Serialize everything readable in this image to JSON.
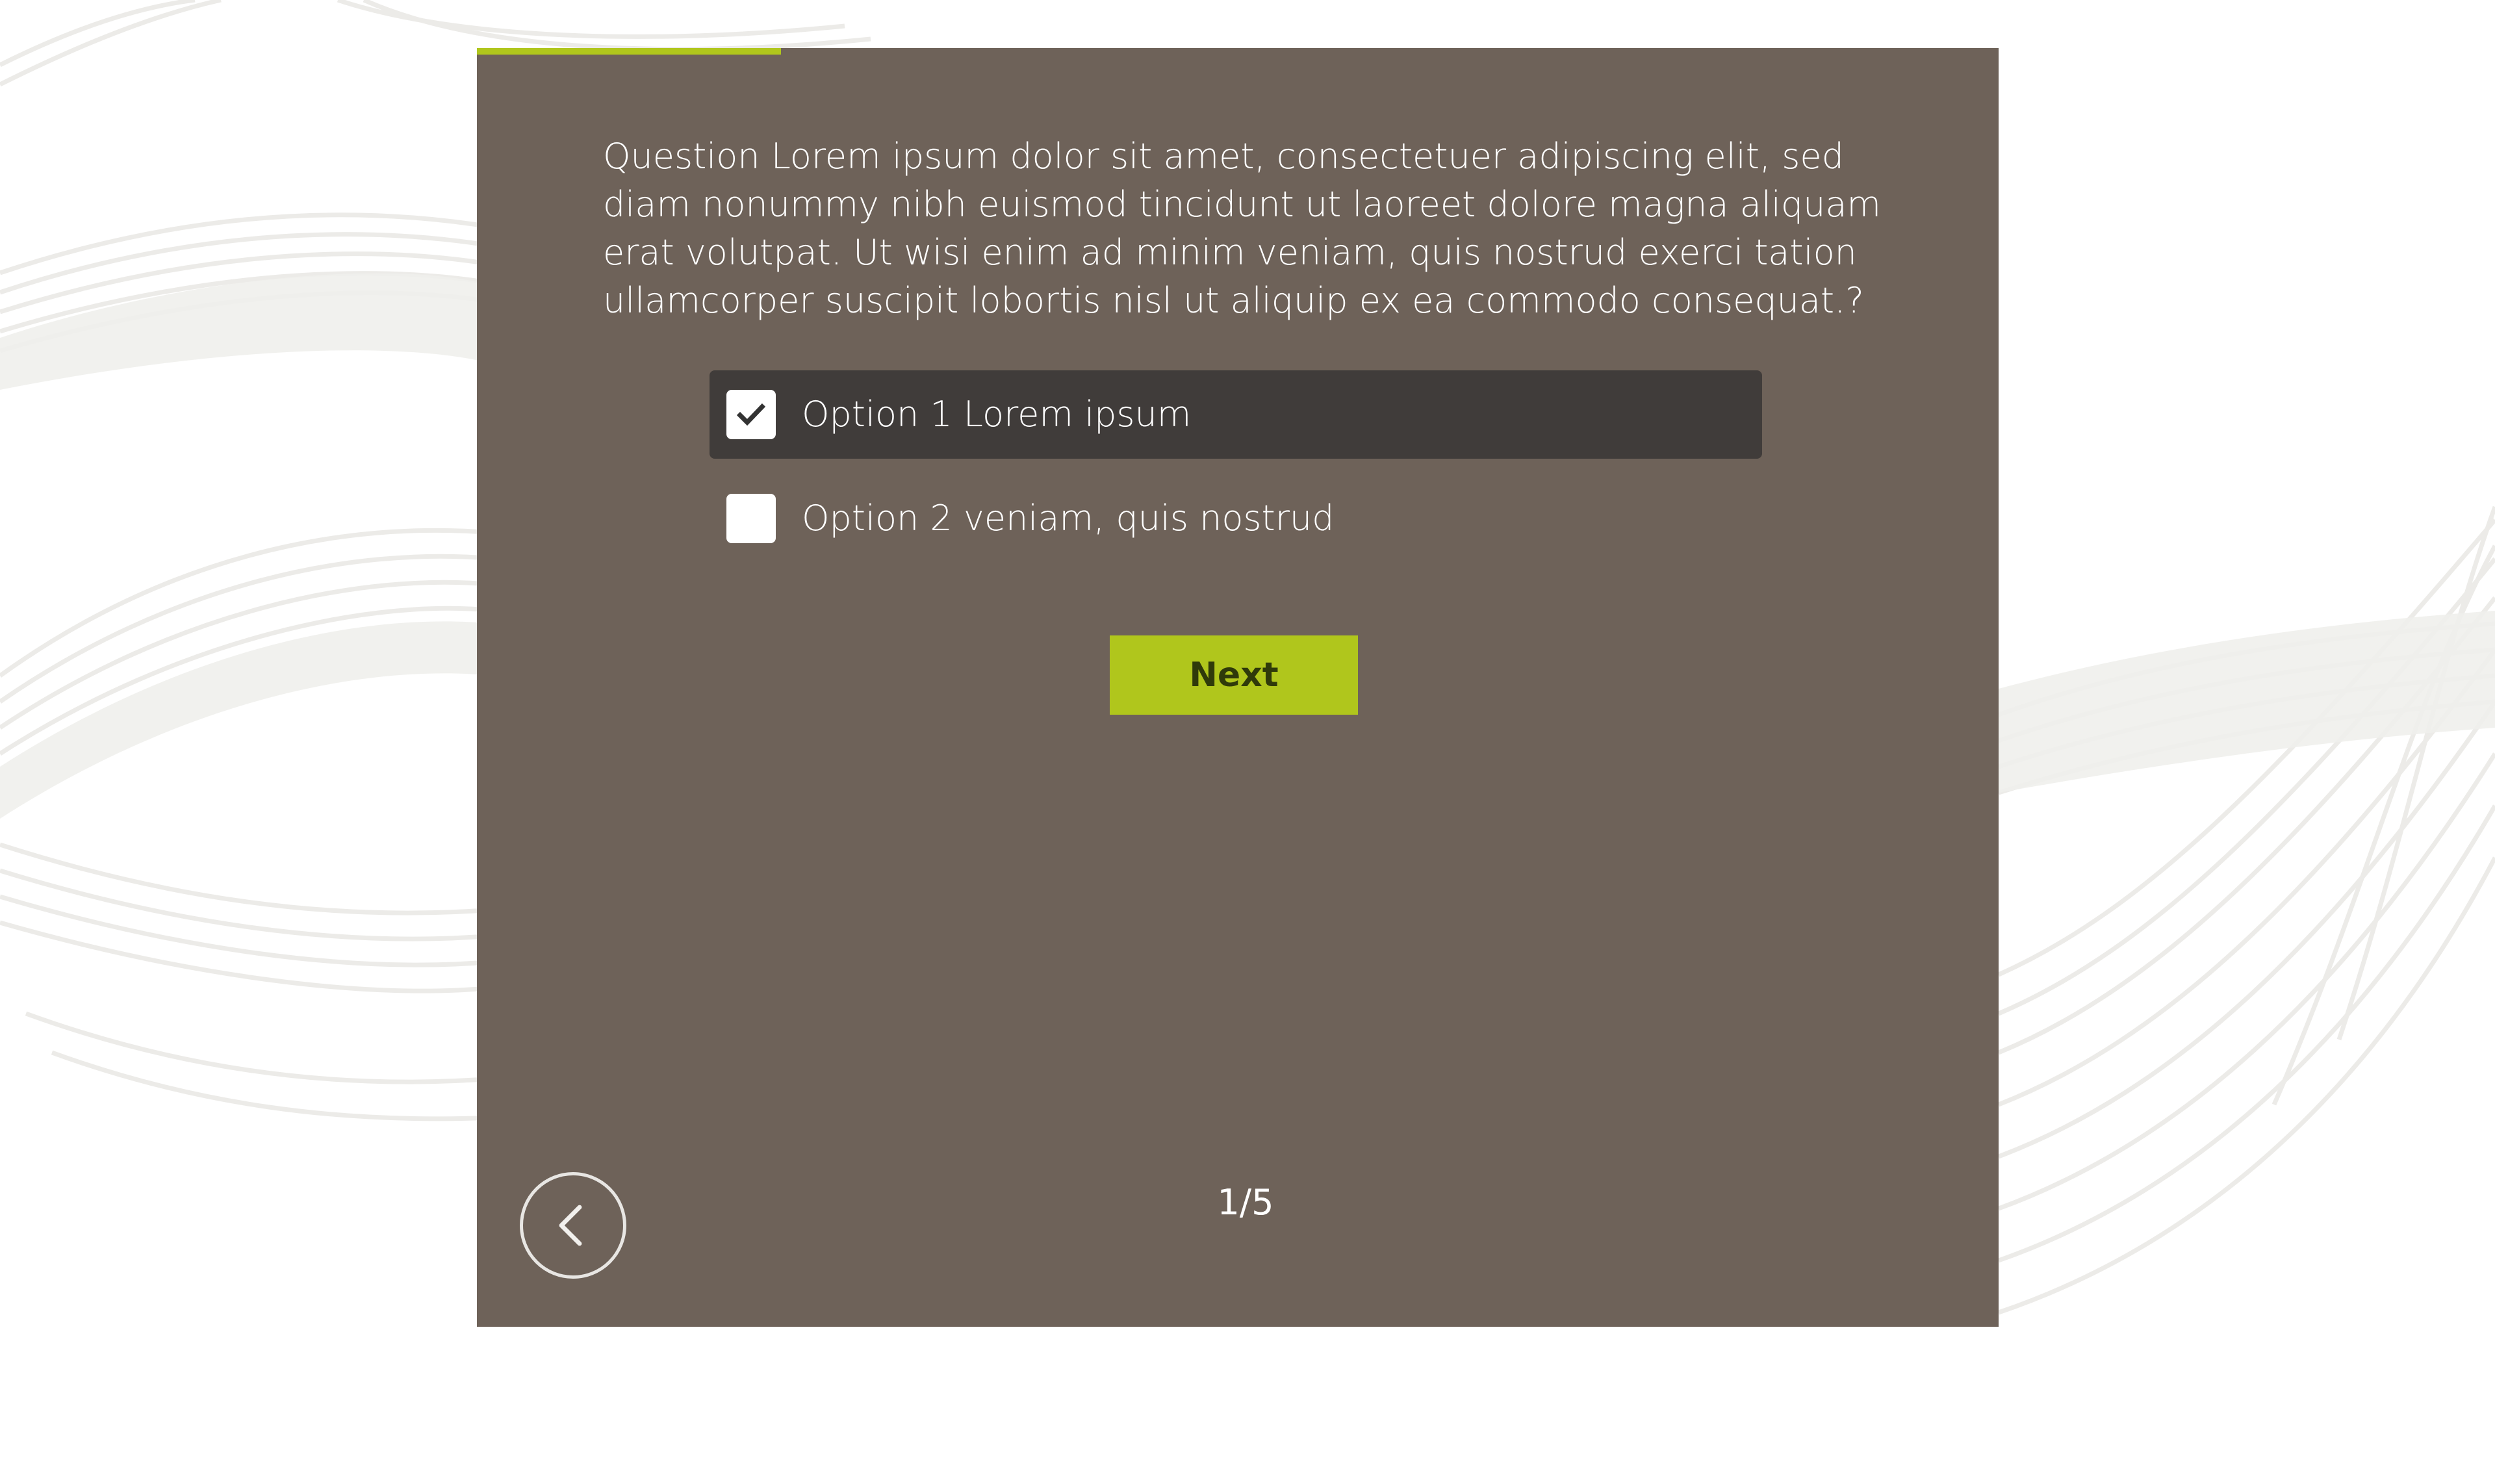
{
  "quiz": {
    "question": "Question Lorem ipsum dolor sit amet, consectetuer adipiscing elit, sed diam nonummy nibh euismod tincidunt ut laoreet dolore magna aliquam erat volutpat. Ut wisi enim ad minim veniam, quis nostrud exerci tation ullamcorper suscipit lobortis nisl ut aliquip ex ea commodo consequat.?",
    "options": [
      {
        "label": "Option 1 Lorem ipsum",
        "checked": true
      },
      {
        "label": "Option 2 veniam, quis nostrud",
        "checked": false
      }
    ],
    "next_label": "Next",
    "page_counter": "1/5",
    "progress_fraction": 0.2
  },
  "icons": {
    "check": "check-icon",
    "back": "chevron-left-icon"
  },
  "colors": {
    "card_background": "#6e6259",
    "accent": "#b0c61c",
    "selected_option_background": "#403c3a",
    "text": "#ffffff"
  }
}
